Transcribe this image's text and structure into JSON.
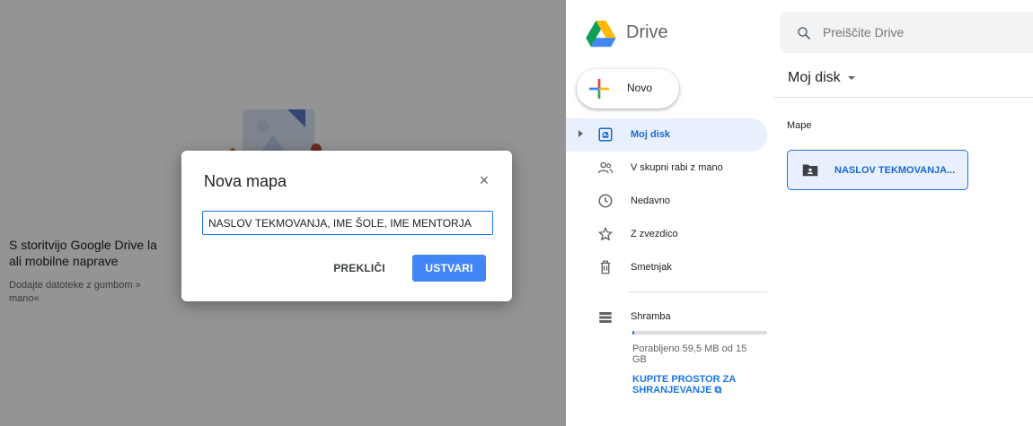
{
  "left_panel": {
    "title": "S storitvijo Google Drive la\nali mobilne naprave",
    "subtitle": "Dodajte datoteke z gumbom »\nmano«"
  },
  "dialog": {
    "title": "Nova mapa",
    "close_label": "×",
    "input_value": "NASLOV TEKMOVANJA, IME ŠOLE, IME MENTORJA",
    "cancel_label": "PREKLIČI",
    "create_label": "USTVARI"
  },
  "header": {
    "app_title": "Drive",
    "search_placeholder": "Preiščite Drive"
  },
  "sidebar": {
    "new_label": "Novo",
    "items": [
      {
        "label": "Moj disk",
        "icon": "my-drive-icon",
        "active": true
      },
      {
        "label": "V skupni rabi z mano",
        "icon": "shared-icon",
        "active": false
      },
      {
        "label": "Nedavno",
        "icon": "clock-icon",
        "active": false
      },
      {
        "label": "Z zvezdico",
        "icon": "star-icon",
        "active": false
      },
      {
        "label": "Smetnjak",
        "icon": "trash-icon",
        "active": false
      }
    ],
    "storage": {
      "label": "Shramba",
      "used_text": "Porabljeno 59,5 MB od 15 GB",
      "used_fraction": 0.004,
      "buy_label": "KUPITE PROSTOR ZA SHRANJEVANJE ⧉"
    }
  },
  "main": {
    "breadcrumb": "Moj disk",
    "section_label": "Mape",
    "folders": [
      {
        "name": "NASLOV TEKMOVANJA..."
      }
    ]
  },
  "colors": {
    "accent": "#1a73e8",
    "active_bg": "#e8f0fe",
    "create_button": "#4285f4",
    "overlay": "#6b6b6b"
  }
}
